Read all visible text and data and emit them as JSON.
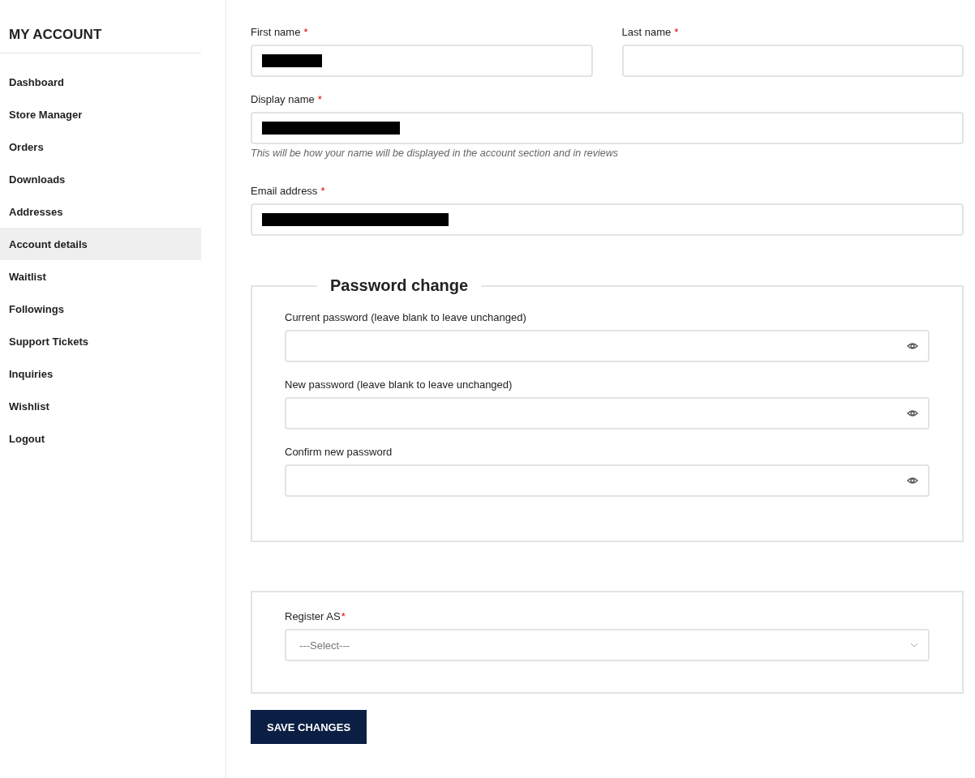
{
  "sidebar": {
    "title": "MY ACCOUNT",
    "items": [
      {
        "label": "Dashboard",
        "selected": false
      },
      {
        "label": "Store Manager",
        "selected": false
      },
      {
        "label": "Orders",
        "selected": false
      },
      {
        "label": "Downloads",
        "selected": false
      },
      {
        "label": "Addresses",
        "selected": false
      },
      {
        "label": "Account details",
        "selected": true
      },
      {
        "label": "Waitlist",
        "selected": false
      },
      {
        "label": "Followings",
        "selected": false
      },
      {
        "label": "Support Tickets",
        "selected": false
      },
      {
        "label": "Inquiries",
        "selected": false
      },
      {
        "label": "Wishlist",
        "selected": false
      },
      {
        "label": "Logout",
        "selected": false
      }
    ]
  },
  "account_fields": [
    {
      "label": "First name",
      "required_mark": "*",
      "redacted": true
    },
    {
      "label": "Last name",
      "required_mark": "*",
      "redacted": false
    },
    {
      "label": "Display name",
      "required_mark": "*",
      "redacted": true,
      "hint": "This will be how your name will be displayed in the account section and in reviews"
    },
    {
      "label": "Email address",
      "required_mark": "*",
      "redacted": true
    }
  ],
  "password_change": {
    "legend": "Password change",
    "fields": [
      {
        "label": "Current password (leave blank to leave unchanged)"
      },
      {
        "label": "New password (leave blank to leave unchanged)"
      },
      {
        "label": "Confirm new password"
      }
    ]
  },
  "register": {
    "label": "Register AS",
    "required_mark": "*",
    "placeholder": "---Select---"
  },
  "save_button": "SAVE CHANGES"
}
